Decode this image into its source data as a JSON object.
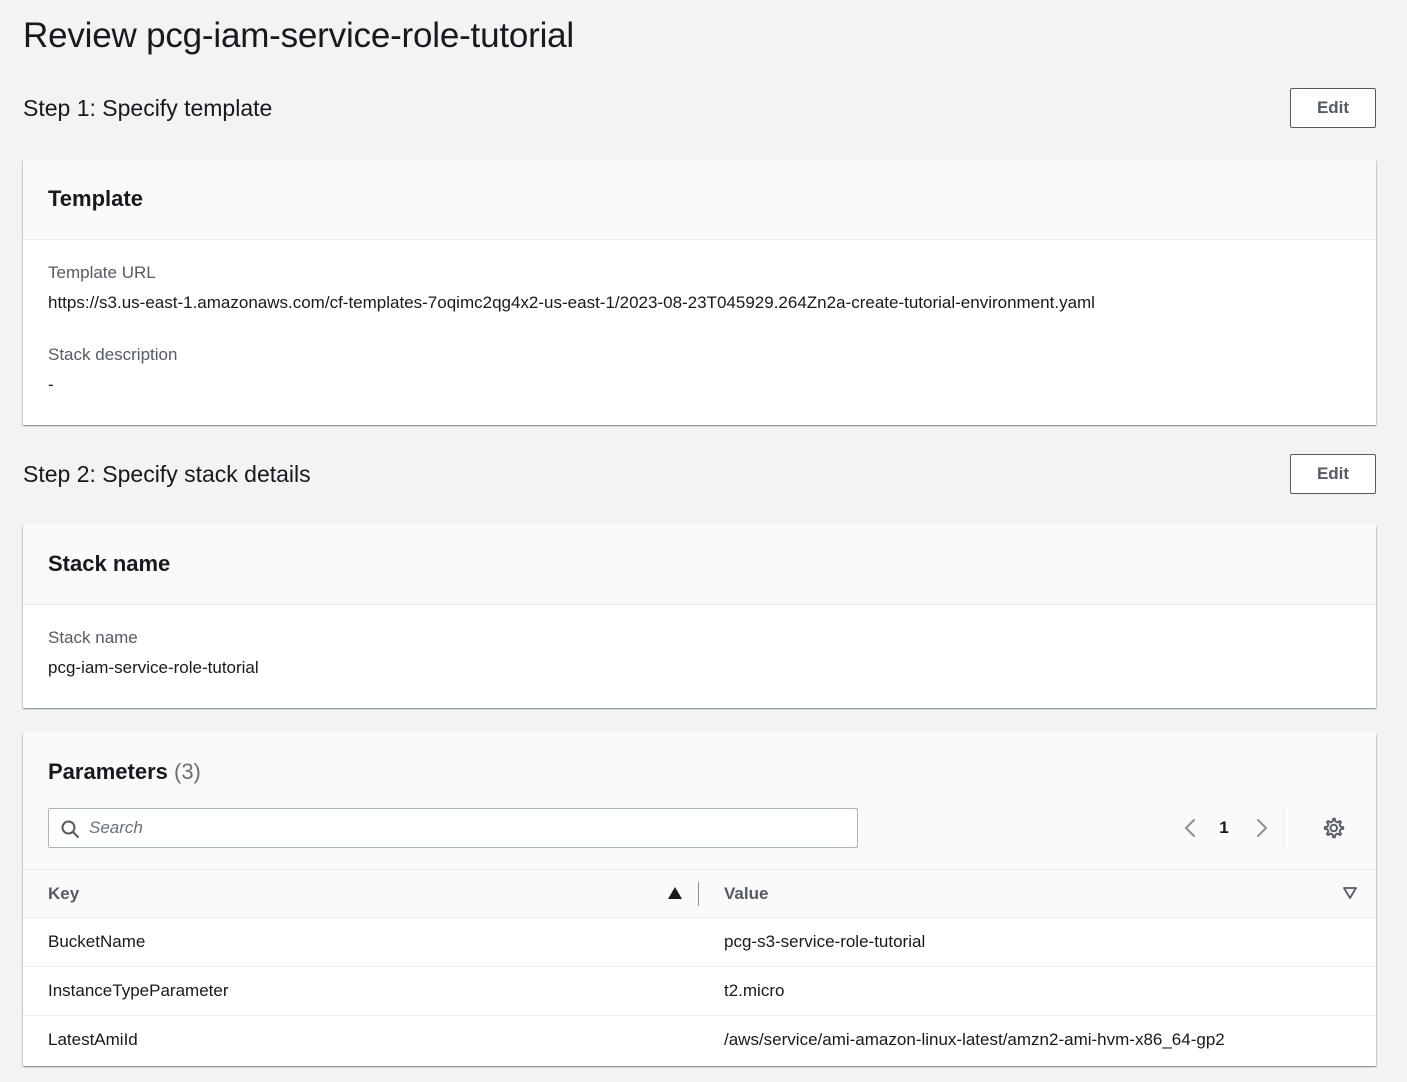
{
  "page_title": "Review pcg-iam-service-role-tutorial",
  "step1": {
    "title": "Step 1: Specify template",
    "edit_label": "Edit",
    "card_title": "Template",
    "template_url_label": "Template URL",
    "template_url_value": "https://s3.us-east-1.amazonaws.com/cf-templates-7oqimc2qg4x2-us-east-1/2023-08-23T045929.264Zn2a-create-tutorial-environment.yaml",
    "stack_description_label": "Stack description",
    "stack_description_value": "-"
  },
  "step2": {
    "title": "Step 2: Specify stack details",
    "edit_label": "Edit",
    "card_title": "Stack name",
    "stack_name_label": "Stack name",
    "stack_name_value": "pcg-iam-service-role-tutorial"
  },
  "parameters": {
    "title": "Parameters",
    "count": "(3)",
    "search_placeholder": "Search",
    "current_page": "1",
    "columns": {
      "key": "Key",
      "value": "Value"
    },
    "rows": [
      {
        "key": "BucketName",
        "value": "pcg-s3-service-role-tutorial"
      },
      {
        "key": "InstanceTypeParameter",
        "value": "t2.micro"
      },
      {
        "key": "LatestAmiId",
        "value": "/aws/service/ami-amazon-linux-latest/amzn2-ami-hvm-x86_64-gp2"
      }
    ]
  },
  "icons": {
    "search": "search-icon",
    "prev": "chevron-left-icon",
    "next": "chevron-right-icon",
    "settings": "gear-icon",
    "sort_asc": "sort-ascending-icon",
    "sort_desc": "sort-descending-icon"
  },
  "colors": {
    "background": "#f2f3f3",
    "card": "#ffffff",
    "card_header": "#fafafa",
    "text_primary": "#16191f",
    "text_secondary": "#545b64"
  }
}
